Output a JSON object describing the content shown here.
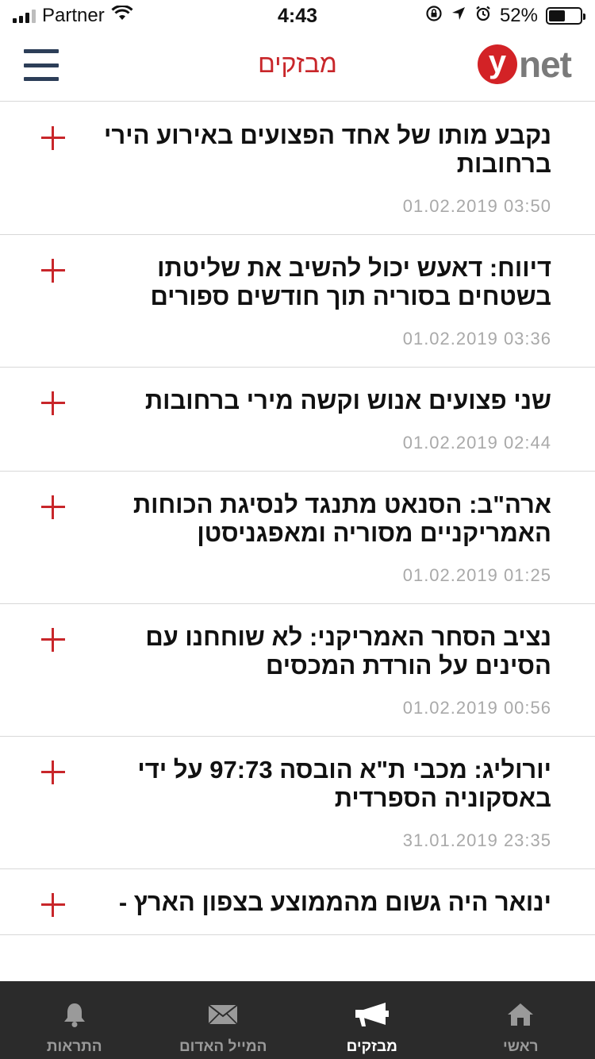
{
  "status_bar": {
    "carrier": "Partner",
    "time": "4:43",
    "battery_percent": "52%",
    "battery_level": 0.52
  },
  "header": {
    "title": "מבזקים",
    "logo_y": "y",
    "logo_net": "net"
  },
  "news": [
    {
      "headline": "נקבע מותו של אחד הפצועים באירוע הירי ברחובות",
      "timestamp": "01.02.2019 03:50"
    },
    {
      "headline": "דיווח: דאעש יכול להשיב את שליטתו בשטחים בסוריה תוך חודשים ספורים",
      "timestamp": "01.02.2019 03:36"
    },
    {
      "headline": "שני פצועים אנוש וקשה מירי ברחובות",
      "timestamp": "01.02.2019 02:44"
    },
    {
      "headline": "ארה\"ב: הסנאט מתנגד לנסיגת הכוחות האמריקניים מסוריה ומאפגניסטן",
      "timestamp": "01.02.2019 01:25"
    },
    {
      "headline": "נציב הסחר האמריקני: לא שוחחנו עם הסינים על הורדת המכסים",
      "timestamp": "01.02.2019 00:56"
    },
    {
      "headline": "יורוליג: מכבי ת\"א הובסה 97:73 על ידי באסקוניה הספרדית",
      "timestamp": "31.01.2019 23:35"
    },
    {
      "headline": "ינואר היה גשום מהממוצע בצפון הארץ -",
      "timestamp": ""
    }
  ],
  "tabs": [
    {
      "label": "התראות",
      "icon": "bell-icon",
      "active": false
    },
    {
      "label": "המייל האדום",
      "icon": "envelope-icon",
      "active": false
    },
    {
      "label": "מבזקים",
      "icon": "megaphone-icon",
      "active": true
    },
    {
      "label": "ראשי",
      "icon": "home-icon",
      "active": false
    }
  ],
  "colors": {
    "accent": "#c8262a",
    "menu": "#2c3e58",
    "tab_bar": "#2b2b2b",
    "timestamp": "#a9a9a9"
  }
}
